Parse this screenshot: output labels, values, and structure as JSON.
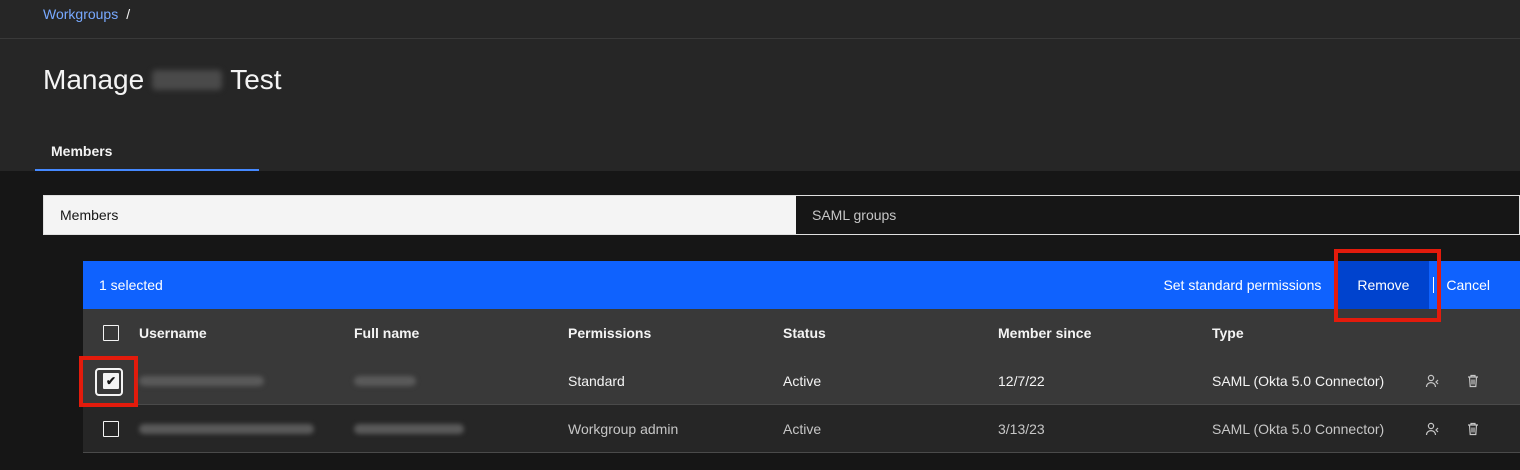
{
  "breadcrumb": {
    "link": "Workgroups",
    "separator": "/"
  },
  "page": {
    "title_prefix": "Manage",
    "title_suffix": "Test"
  },
  "tabs": [
    {
      "label": "Members",
      "active": true
    }
  ],
  "switcher": {
    "active": "Members",
    "inactive": "SAML groups"
  },
  "batch": {
    "selected": "1 selected",
    "set_permissions": "Set standard permissions",
    "remove": "Remove",
    "cancel": "Cancel"
  },
  "table": {
    "headers": [
      "Username",
      "Full name",
      "Permissions",
      "Status",
      "Member since",
      "Type"
    ],
    "rows": [
      {
        "selected": true,
        "permissions": "Standard",
        "status": "Active",
        "member_since": "12/7/22",
        "type": "SAML (Okta 5.0 Connector)"
      },
      {
        "selected": false,
        "permissions": "Workgroup admin",
        "status": "Active",
        "member_since": "3/13/23",
        "type": "SAML (Okta 5.0 Connector)"
      }
    ]
  },
  "colors": {
    "accent": "#0f62fe",
    "highlight": "#e31b0c",
    "link": "#78a9ff"
  },
  "icons": {
    "row_action_1": "user-role-icon",
    "row_action_2": "trash-icon",
    "check": "checkmark-icon"
  }
}
